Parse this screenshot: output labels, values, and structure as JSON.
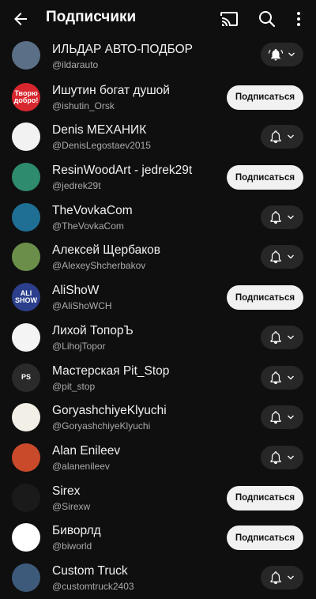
{
  "header": {
    "title": "Подписчики",
    "icons": [
      "back-arrow-icon",
      "cast-icon",
      "search-icon",
      "more-vertical-icon"
    ]
  },
  "colors": {
    "background": "#0f0f0f",
    "text": "#f1f1f1",
    "secondary_text": "#aaaaaa",
    "bell_button_bg": "#272727",
    "subscribe_button_bg": "#f1f1f1"
  },
  "subscribers": [
    {
      "name": "ИЛЬДАР АВТО-ПОДБОР",
      "handle": "@ildarauto",
      "action": "bell",
      "bell_icon": "bell-ring-icon",
      "avatar_color": "#5b6f86",
      "avatar_text": ""
    },
    {
      "name": "Ишутин богат душой",
      "handle": "@ishutin_Orsk",
      "action": "subscribe",
      "button_label": "Подписаться",
      "avatar_color": "#d7262e",
      "avatar_text": "Творю добро!"
    },
    {
      "name": "Denis МЕХАНИК",
      "handle": "@DenisLegostaev2015",
      "action": "bell",
      "bell_icon": "bell-icon",
      "avatar_color": "#f2f2f2",
      "avatar_text": ""
    },
    {
      "name": "ResinWoodArt - jedrek29t",
      "handle": "@jedrek29t",
      "action": "subscribe",
      "button_label": "Подписаться",
      "avatar_color": "#2e8b6d",
      "avatar_text": ""
    },
    {
      "name": "TheVovkaCom",
      "handle": "@TheVovkaCom",
      "action": "bell",
      "bell_icon": "bell-icon",
      "avatar_color": "#1f6f95",
      "avatar_text": ""
    },
    {
      "name": "Алексей Щербаков",
      "handle": "@AlexeyShcherbakov",
      "action": "bell",
      "bell_icon": "bell-icon",
      "avatar_color": "#6b8f4a",
      "avatar_text": ""
    },
    {
      "name": "AliShoW",
      "handle": "@AliShoWCH",
      "action": "subscribe",
      "button_label": "Подписаться",
      "avatar_color": "#2c3f8c",
      "avatar_text": "ALI SHOW"
    },
    {
      "name": "Лихой ТопорЪ",
      "handle": "@LihojTopor",
      "action": "bell",
      "bell_icon": "bell-icon",
      "avatar_color": "#f4f4f4",
      "avatar_text": ""
    },
    {
      "name": "Мастерская Pit_Stop",
      "handle": "@pit_stop",
      "action": "bell",
      "bell_icon": "bell-icon",
      "avatar_color": "#2a2a2a",
      "avatar_text": "PS"
    },
    {
      "name": "GoryashchiyeKlyuchi",
      "handle": "@GoryashchiyeKlyuchi",
      "action": "bell",
      "bell_icon": "bell-icon",
      "avatar_color": "#f2efe6",
      "avatar_text": ""
    },
    {
      "name": "Alan Enileev",
      "handle": "@alanenileev",
      "action": "bell",
      "bell_icon": "bell-icon",
      "avatar_color": "#c94a2a",
      "avatar_text": ""
    },
    {
      "name": "Sirex",
      "handle": "@Sirexw",
      "action": "subscribe",
      "button_label": "Подписаться",
      "avatar_color": "#1a1a1a",
      "avatar_text": ""
    },
    {
      "name": "Биворлд",
      "handle": "@biworld",
      "action": "subscribe",
      "button_label": "Подписаться",
      "avatar_color": "#ffffff",
      "avatar_text": ""
    },
    {
      "name": "Custom Truck",
      "handle": "@customtruck2403",
      "action": "bell",
      "bell_icon": "bell-icon",
      "avatar_color": "#3d5a7a",
      "avatar_text": ""
    }
  ]
}
